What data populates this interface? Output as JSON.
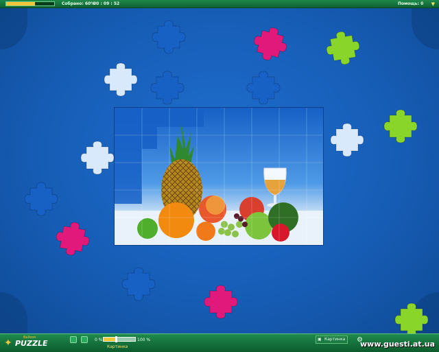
{
  "top_bar": {
    "progress_fraction": 0.6,
    "collected_label": "Собрано: 60%",
    "timer": "00 : 09 : 52",
    "help_label": "Помощь: 0",
    "help_icon": "down-arrow-icon"
  },
  "bottom_bar": {
    "logo_small": "Balloon",
    "logo_big": "PUZZLE",
    "zoom_min_label": "0 %",
    "zoom_max_label": "100 %",
    "zoom_fraction": 0.4,
    "picture_label": "Картинка",
    "picture_button_label": "Картинка",
    "settings_icon": "gear-icon",
    "watermark": "www.guesti.at.ua"
  },
  "colors": {
    "board": "#1a5fb4",
    "bar": "#1f8a4c",
    "accent": "#f3c53a",
    "piece_blue": "#1760c4",
    "piece_pink": "#e0197a",
    "piece_green": "#8ad52a",
    "piece_light": "#d7e9fb"
  },
  "pieces": [
    {
      "color": "light"
    },
    {
      "color": "pink"
    },
    {
      "color": "green"
    },
    {
      "color": "blue"
    },
    {
      "color": "blue"
    },
    {
      "color": "blue"
    },
    {
      "color": "light"
    },
    {
      "color": "pink"
    },
    {
      "color": "green"
    },
    {
      "color": "light"
    },
    {
      "color": "blue"
    },
    {
      "color": "pink"
    },
    {
      "color": "green"
    },
    {
      "color": "blue"
    }
  ]
}
